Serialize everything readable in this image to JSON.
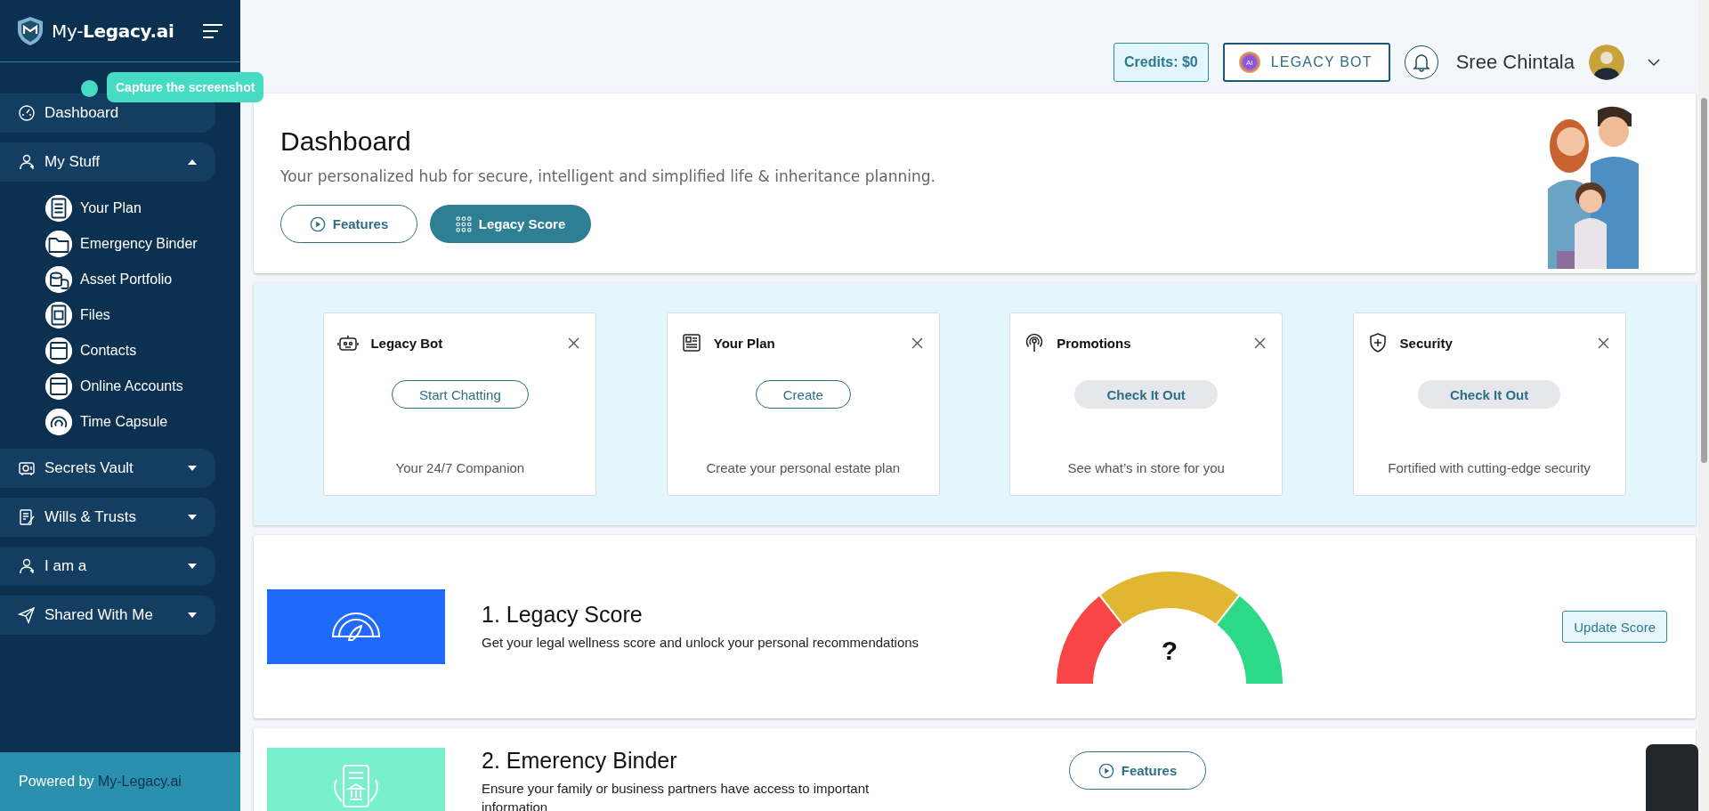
{
  "sidebar": {
    "logo": "My-**Legacy.ai**",
    "tooltip": "Capture the screenshot",
    "nav": [
      {
        "kind": "link",
        "label": "Dashboard"
      },
      {
        "kind": "group",
        "label": "My Stuff",
        "expanded": true,
        "children": [
          {
            "label": "Your Plan"
          },
          {
            "label": "Emergency Binder"
          },
          {
            "label": "Asset Portfolio"
          },
          {
            "label": "Files"
          },
          {
            "label": "Contacts"
          },
          {
            "label": "Online Accounts"
          },
          {
            "label": "Time Capsule"
          }
        ]
      },
      {
        "kind": "group",
        "label": "Secrets Vault",
        "expanded": false
      },
      {
        "kind": "group",
        "label": "Wills & Trusts",
        "expanded": false
      },
      {
        "kind": "group",
        "label": "I am a",
        "expanded": false
      },
      {
        "kind": "group",
        "label": "Shared With Me",
        "expanded": false
      }
    ],
    "footer": {
      "text": "Powered by",
      "link": "My-Legacy.ai"
    }
  },
  "topbar": {
    "credits": "Credits: $0",
    "bot_badge": "AI",
    "bot_label": "LEGACY BOT",
    "user_name": "Sree Chintala"
  },
  "header": {
    "title": "Dashboard",
    "subtitle": "Your personalized hub for secure, intelligent and simplified life & inheritance planning.",
    "buttons": [
      {
        "kind": "outline",
        "label": "Features"
      },
      {
        "kind": "filled",
        "label": "Legacy Score"
      }
    ]
  },
  "quick_cards": [
    {
      "title": "Legacy Bot",
      "button": {
        "kind": "outline",
        "label": "Start Chatting"
      },
      "description": "Your 24/7 Companion"
    },
    {
      "title": "Your Plan",
      "button": {
        "kind": "outline",
        "label": "Create"
      },
      "description": "Create your personal estate plan"
    },
    {
      "title": "Promotions",
      "button": {
        "kind": "muted",
        "label": "Check It Out"
      },
      "description": "See what’s in store for you"
    },
    {
      "title": "Security",
      "button": {
        "kind": "muted",
        "label": "Check It Out"
      },
      "description": "Fortified with cutting-edge security"
    }
  ],
  "sections": [
    {
      "kind": "gauge",
      "title": "1. Legacy Score",
      "description": "Get your legal wellness score and unlock your personal recommendations",
      "gauge_label": "?",
      "button": "Update Score"
    },
    {
      "kind": "features",
      "title": "2. Emerency Binder",
      "description": "Ensure your family or business partners have access to important information",
      "button": "Features"
    }
  ]
}
